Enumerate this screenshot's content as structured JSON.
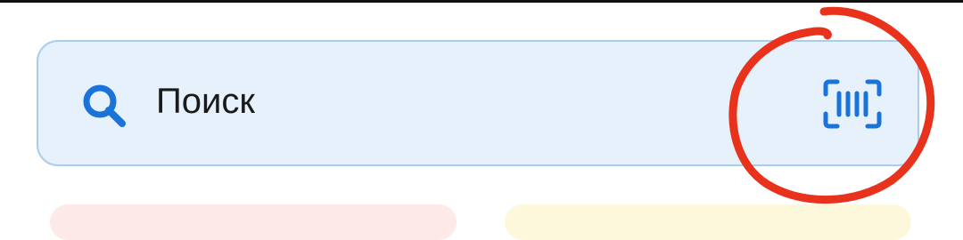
{
  "search": {
    "placeholder": "Поиск",
    "value": "",
    "leading_icon": "search-icon",
    "trailing_icon": "barcode-scan-icon"
  },
  "annotation": {
    "shape": "hand-drawn-circle",
    "color": "#e8321c"
  },
  "colors": {
    "search_background": "#e6f1fb",
    "search_border": "#a9cdee",
    "icon_blue": "#1a73d9",
    "card_left": "#fde9e8",
    "card_right": "#fdf8dc"
  }
}
